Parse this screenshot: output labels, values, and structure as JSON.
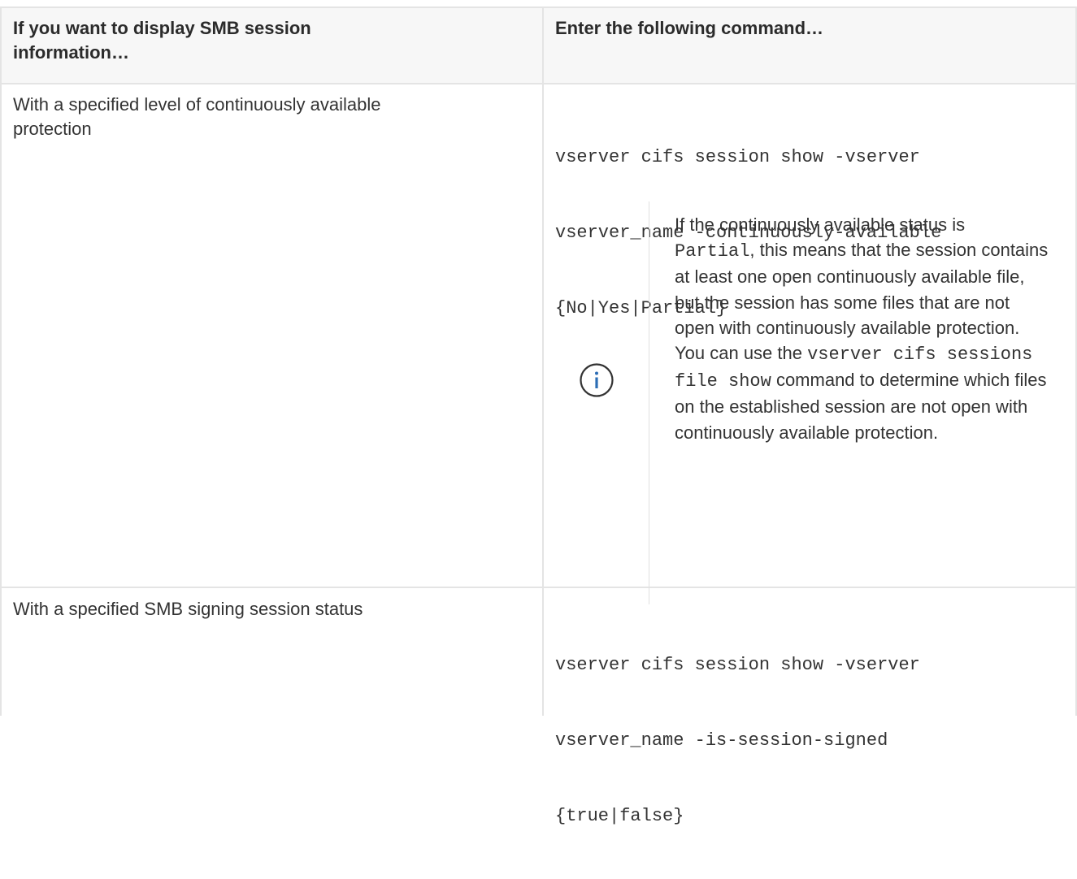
{
  "table": {
    "header": {
      "col1_line1": "If you want to display SMB session",
      "col1_line2": "information…",
      "col2": "Enter the following command…"
    },
    "rows": [
      {
        "description_line1": "With a specified level of continuously available",
        "description_line2": "protection",
        "command_lines": [
          "vserver cifs session show -vserver",
          "vserver_name -continuously-available",
          "{No|Yes|Partial}"
        ],
        "note": {
          "icon": "info-icon",
          "text_1": "If the continuously available status is ",
          "code_1": "Partial",
          "text_2": ", this means that the session contains at least one open continuously available file, but the session has some files that are not open with continuously available protection. You can use the ",
          "code_2": "vserver cifs sessions file show",
          "text_3": " command to determine which files on the established session are not open with continuously available protection."
        }
      },
      {
        "description": "With a specified SMB signing session status",
        "command_lines": [
          "vserver cifs session show -vserver",
          "vserver_name -is-session-signed",
          "{true|false}"
        ]
      }
    ]
  },
  "colors": {
    "border": "#e4e4e4",
    "header_background": "#f7f7f7",
    "icon_color": "#2c6db5"
  }
}
